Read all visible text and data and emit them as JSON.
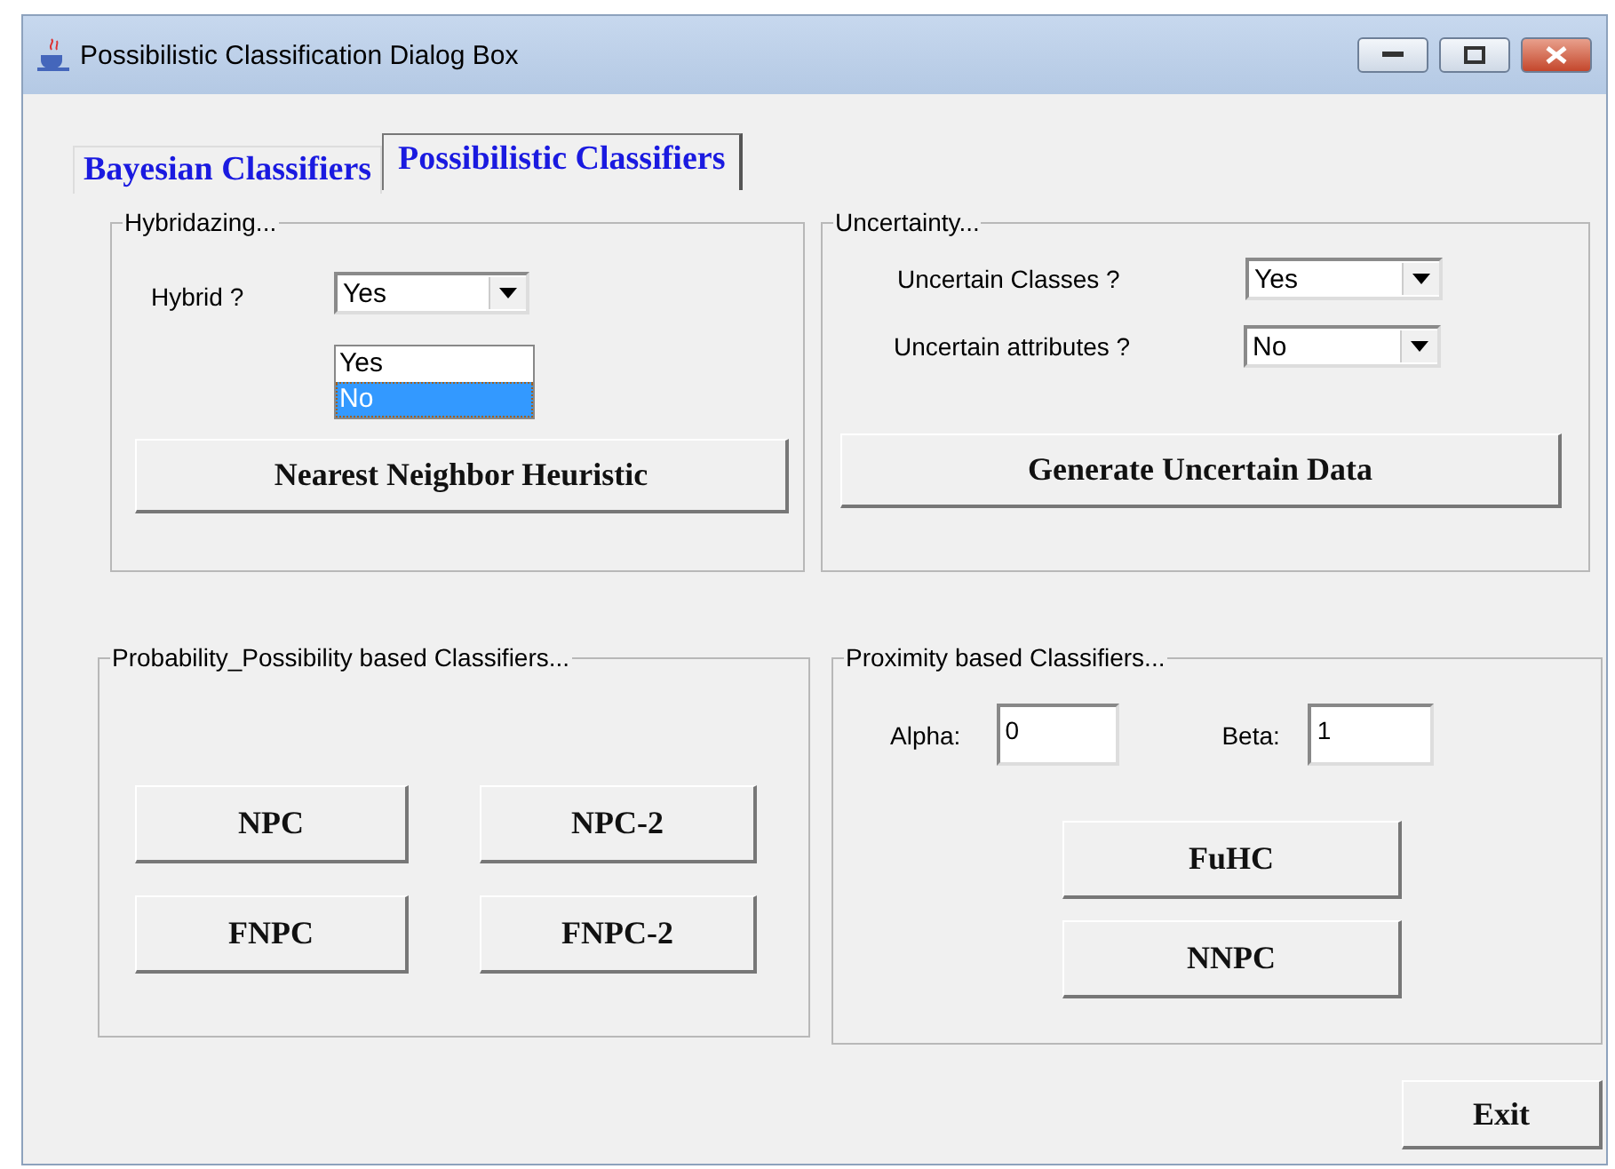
{
  "window": {
    "title": "Possibilistic Classification Dialog Box"
  },
  "tabs": [
    {
      "label": "Bayesian Classifiers",
      "selected": false
    },
    {
      "label": "Possibilistic Classifiers",
      "selected": true
    }
  ],
  "hybridizing": {
    "title": "Hybridazing...",
    "label": "Hybrid ?",
    "value": "Yes",
    "expanded": true,
    "options": [
      {
        "label": "Yes",
        "highlighted": false
      },
      {
        "label": "No",
        "highlighted": true
      }
    ],
    "button": "Nearest Neighbor Heuristic"
  },
  "uncertainty": {
    "title": "Uncertainty...",
    "fields": [
      {
        "label": "Uncertain Classes ?",
        "value": "Yes"
      },
      {
        "label": "Uncertain attributes ?",
        "value": "No"
      }
    ],
    "button": "Generate Uncertain Data"
  },
  "probability_panel": {
    "title": "Probability_Possibility based Classifiers...",
    "buttons": [
      "NPC",
      "NPC-2",
      "FNPC",
      "FNPC-2"
    ]
  },
  "proximity_panel": {
    "title": "Proximity based Classifiers...",
    "fields": [
      {
        "label": "Alpha:",
        "value": "0"
      },
      {
        "label": "Beta:",
        "value": "1"
      }
    ],
    "buttons": [
      "FuHC",
      "NNPC"
    ]
  },
  "exit_button": "Exit"
}
